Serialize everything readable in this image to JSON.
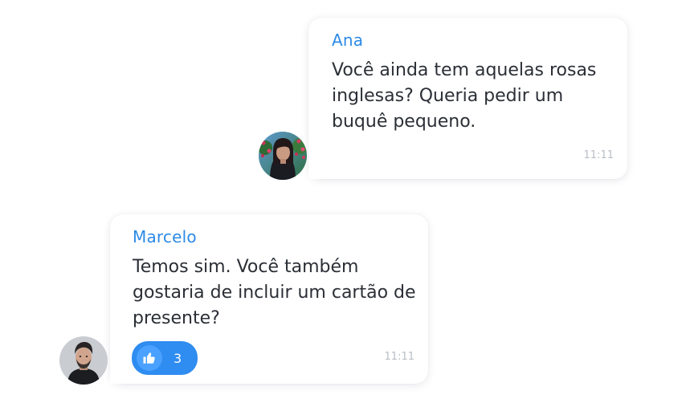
{
  "messages": [
    {
      "sender": "Ana",
      "text": "Você ainda tem aquelas rosas inglesas? Queria pedir um buquê pequeno.",
      "time": "11:11"
    },
    {
      "sender": "Marcelo",
      "text": "Temos sim. Você também gostaria de incluir um cartão de presente?",
      "time": "11:11",
      "reaction": {
        "icon": "thumbs-up-icon",
        "count": "3"
      }
    }
  ],
  "colors": {
    "sender_name": "#2d8ae6",
    "reaction_background": "#2f8cf0",
    "timestamp": "#b9bec6"
  }
}
